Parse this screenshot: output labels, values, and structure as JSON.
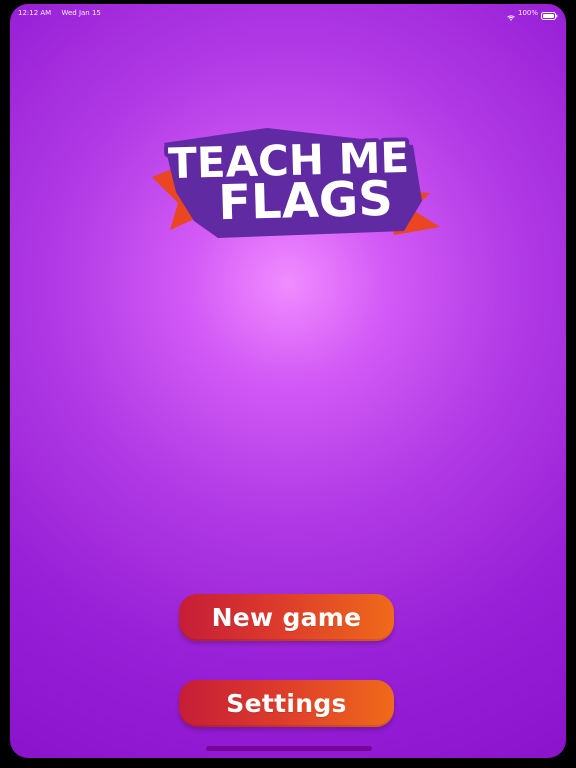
{
  "status_bar": {
    "time": "12:12 AM",
    "date": "Wed Jan 15",
    "battery": "100%"
  },
  "logo": {
    "line1": "TEACH ME",
    "line2": "FLAGS"
  },
  "buttons": {
    "new_game": "New game",
    "settings": "Settings"
  },
  "colors": {
    "background": "#b13be5",
    "button_start": "#c61d37",
    "button_end": "#f06a1a",
    "logo_fill": "#ffffff",
    "logo_outline": "#5f2aa2",
    "ribbon": "#e94621"
  },
  "icons": {
    "wifi": "wifi-icon",
    "battery": "battery-icon"
  }
}
